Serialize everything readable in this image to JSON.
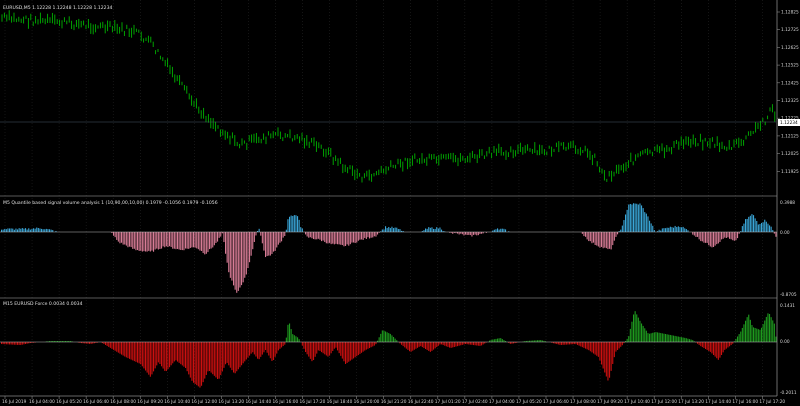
{
  "main_pane": {
    "label": "EURUSD,M5  1.12228 1.12248 1.12228 1.12234",
    "price_labels": [
      "1.12825",
      "1.12725",
      "1.12625",
      "1.12525",
      "1.12425",
      "1.12325",
      "1.12225",
      "1.12125",
      "1.12025",
      "1.11925"
    ],
    "current_price": "1.12234"
  },
  "indicator1": {
    "label": "M5 Quantile based signal volume analysis 1 (10,90,00,10,00) 0.1979 -0.1056 0.1979 -0.1056",
    "scale": [
      "0.3988",
      "0.00",
      "-0.8705"
    ]
  },
  "indicator2": {
    "label": "M15 EURUSD Force 0.0034 0.0034",
    "scale": [
      "0.1431",
      "0.00",
      "-0.2011"
    ]
  },
  "time_axis": [
    "16 Jul 2019",
    "16 Jul 04:00",
    "16 Jul 05:20",
    "16 Jul 06:40",
    "16 Jul 08:00",
    "16 Jul 09:20",
    "16 Jul 10:40",
    "16 Jul 12:00",
    "16 Jul 13:20",
    "16 Jul 14:40",
    "16 Jul 16:00",
    "16 Jul 17:20",
    "16 Jul 18:40",
    "16 Jul 20:00",
    "16 Jul 21:20",
    "16 Jul 22:40",
    "17 Jul 01:20",
    "17 Jul 02:40",
    "17 Jul 04:00",
    "17 Jul 05:20",
    "17 Jul 06:40",
    "17 Jul 08:00",
    "17 Jul 09:20",
    "17 Jul 10:40",
    "17 Jul 12:00",
    "17 Jul 13:20",
    "17 Jul 14:40",
    "17 Jul 16:00",
    "17 Jul 17:20"
  ],
  "colors": {
    "background": "#000000",
    "grid": "#2a2a2a",
    "candle": "#00b400",
    "bar_positive": "#3aa6d8",
    "bar_negative": "#d87c96",
    "force_positive": "#1e9b1e",
    "force_negative": "#cc1010",
    "axis_text": "#d8d8d8"
  }
}
